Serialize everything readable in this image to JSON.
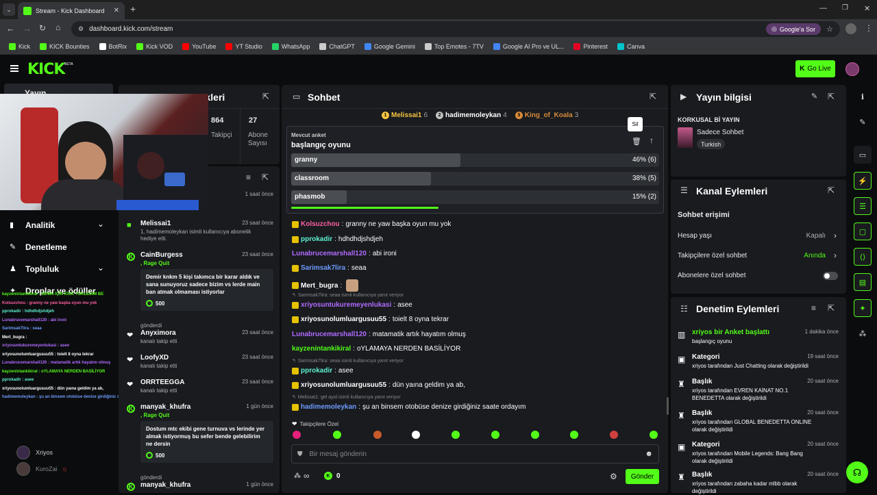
{
  "browser": {
    "tab_title": "Stream - Kick Dashboard",
    "url": "dashboard.kick.com/stream",
    "google_ask": "Google'a Sor",
    "bookmarks": [
      "Kick",
      "KICK Bounties",
      "BotRix",
      "Kick VOD",
      "YouTube",
      "YT Studio",
      "WhatsApp",
      "ChatGPT",
      "Google Gemini",
      "Top Emotes - 7TV",
      "Google AI Pro ve UL...",
      "Pinterest",
      "Canva"
    ]
  },
  "header": {
    "logo": "KICK",
    "beta": "BETA",
    "go_live": "Go Live"
  },
  "sidebar": {
    "stream_label": "Yayın",
    "items": [
      {
        "label": "Analitik",
        "chevron": true
      },
      {
        "label": "Denetleme",
        "chevron": false
      },
      {
        "label": "Topluluk",
        "chevron": true
      },
      {
        "label": "Droplar ve ödüller",
        "chevron": false
      }
    ],
    "accounts": [
      "Xriyos",
      "KuroZai"
    ]
  },
  "stats": {
    "title": "Yayın istatistikleri",
    "followers": "864",
    "followers_label": "Takipçi",
    "subs": "27",
    "subs_label": "Abone Sayısı"
  },
  "feed": {
    "items": [
      {
        "name": "",
        "sub": "kanalı takip etti",
        "time": "1 saat önce",
        "type": "heart"
      },
      {
        "name": "Melissai1",
        "sub": "1, hadimemoleykan isimli kullanıcıya abonelik hediye etti.",
        "time": "23 saat önce",
        "type": "gift"
      },
      {
        "name": "CainBurgess",
        "sub": ", Rage Quit",
        "time": "23 saat önce",
        "type": "kick",
        "message": "Demir knkm 5 kişi takımca bir karar aldık ve sana sunuyoruz sadece bizim vs lerde main ban atmak olmaması istiyorlar",
        "amount": "500",
        "footer": "gönderdi"
      },
      {
        "name": "Anyximora",
        "sub": "kanalı takip etti",
        "time": "23 saat önce",
        "type": "heart"
      },
      {
        "name": "LoofyXD",
        "sub": "kanalı takip etti",
        "time": "23 saat önce",
        "type": "heart"
      },
      {
        "name": "ORRTEEGGA",
        "sub": "kanalı takip etti",
        "time": "23 saat önce",
        "type": "heart"
      },
      {
        "name": "manyak_khufra",
        "sub": ", Rage Quit",
        "time": "1 gün önce",
        "type": "kick",
        "message": "Dostum mtc ekibi gene turnuva vs lerinde yer almak istiyormuş bu sefer bende gelebilirim ne dersin",
        "amount": "500",
        "footer": "gönderdi"
      },
      {
        "name": "manyak_khufra",
        "sub": "",
        "time": "1 gün önce",
        "type": "kick"
      }
    ]
  },
  "chat": {
    "title": "Sohbet",
    "leaders": [
      {
        "rank": "1",
        "name": "Melissai1",
        "count": "6",
        "color": "#f5c542"
      },
      {
        "rank": "2",
        "name": "hadimemoleykan",
        "count": "4",
        "color": "#c0c0c0"
      },
      {
        "rank": "3",
        "name": "King_of_Koala",
        "count": "3",
        "color": "#d98c3a"
      }
    ],
    "poll": {
      "label": "Mevcut anket",
      "question": "başlangıç oyunu",
      "tooltip": "Sil",
      "options": [
        {
          "label": "granny",
          "pct_text": "46% (6)",
          "fraction": 0.46
        },
        {
          "label": "classroom",
          "pct_text": "38% (5)",
          "fraction": 0.38
        },
        {
          "label": "phasmob",
          "pct_text": "15% (2)",
          "fraction": 0.15
        }
      ],
      "timer_fraction": 0.4
    },
    "messages": [
      {
        "user": "Kolsuzchou",
        "color": "#ff5fa2",
        "text": "granny ne yaw başka oyun mu yok"
      },
      {
        "user": "pprokadir",
        "color": "#5ef0d0",
        "text": "hdhdhdjshdjeh"
      },
      {
        "user": "Lunabrucemarshall120",
        "color": "#b06bff",
        "text": "abi ironi"
      },
      {
        "user": "Sarimsak7lira",
        "color": "#6f9bff",
        "text": "seaa"
      },
      {
        "user": "Mert_bugra",
        "color": "#ffffff",
        "text": ""
      },
      {
        "reply": "Sarimsak7lira: seaa isimli kullanıcıya yanıt veriyor",
        "user": "xriyosuntukuremeyenlukasi",
        "color": "#b06bff",
        "text": "asee"
      },
      {
        "user": "xriyosunolumluargusuu55",
        "color": "#ffffff",
        "text": "toielt 8 oyna tekrar"
      },
      {
        "user": "Lunabrucemarshall120",
        "color": "#b06bff",
        "text": "matamatik artık hayatım olmuş"
      },
      {
        "user": "kayzenintankikiral",
        "color": "#53fc18",
        "text": "oYLAMAYA NERDEN BASİLİYOR"
      },
      {
        "reply": "Sarimsak7lira: seaa isimli kullanıcıya yanıt veriyor",
        "user": "pprokadir",
        "color": "#5ef0d0",
        "text": "asee"
      },
      {
        "user": "xriyosunolumluargusuu55",
        "color": "#ffffff",
        "text": "dün yaına geldim ya ab,"
      },
      {
        "reply": "Melissai1: gel ayol isimli kullanıcıya yanıt veriyor",
        "user": "hadimemoleykan",
        "color": "#6f9bff",
        "text": "şu an binsem otobüse denize girdiğiniz saate ordayım"
      }
    ],
    "followers_only": "Takipçilere Özel",
    "input_placeholder": "Bir mesaj gönderin",
    "infinity": "∞",
    "points": "0",
    "send": "Gönder"
  },
  "stream_info": {
    "title": "Yayın bilgisi",
    "stream_title": "KORKUSAL Bİ YAYIN",
    "category": "Sadece Sohbet",
    "language": "Turkish"
  },
  "channel_actions": {
    "title": "Kanal Eylemleri",
    "section": "Sohbet erişimi",
    "rows": [
      {
        "label": "Hesap yaşı",
        "value": "Kapalı",
        "value_color": "#aeb0b5"
      },
      {
        "label": "Takipçilere özel sohbet",
        "value": "Anında",
        "value_color": "#53fc18"
      },
      {
        "label": "Abonelere özel sohbet",
        "value": "",
        "value_color": "#aeb0b5"
      }
    ]
  },
  "mod_actions": {
    "title": "Denetim Eylemleri",
    "rows": [
      {
        "title": "xriyos bir Anket başlattı",
        "desc": "başlangıç oyunu",
        "time": "1 dakika önce"
      },
      {
        "title": "Kategori",
        "desc": "xriyos tarafından Just Chatting olarak değiştirildi",
        "time": "19 saat önce"
      },
      {
        "title": "Başlık",
        "desc": "xriyos tarafından EVREN KAİNAT NO.1 BENEDETTA olarak değiştirildi",
        "time": "20 saat önce"
      },
      {
        "title": "Başlık",
        "desc": "xriyos tarafından GLOBAL BENEDETTA ONLINE olarak değiştirildi",
        "time": "20 saat önce"
      },
      {
        "title": "Kategori",
        "desc": "xriyos tarafından Mobile Legends: Bang Bang olarak değiştirildi",
        "time": "20 saat önce"
      },
      {
        "title": "Başlık",
        "desc": "xriyos tarafından zabaha kadar mlbb olarak değiştirildi",
        "time": "20 saat önce"
      }
    ]
  },
  "stream_overlay_chat": [
    {
      "text": "kayzenintankikiral : SENİN İÇİN KİCK YÜKLEDİM BE",
      "color": "#53fc18"
    },
    {
      "text": "Kolsuzchou : granny ne yaw başka oyun mu yok",
      "color": "#ff5fa2"
    },
    {
      "text": "pprokadir : hdhdhdjshdjeh",
      "color": "#5ef0d0"
    },
    {
      "text": "Lunabrucemarshall120 : abi ironi",
      "color": "#b06bff"
    },
    {
      "text": "Sarimsak7lira : seaa",
      "color": "#6f9bff"
    },
    {
      "text": "Mert_bugra :",
      "color": "#ffffff"
    },
    {
      "text": "xriyosuntukuremeyenlukasi : asee",
      "color": "#b06bff"
    },
    {
      "text": "xriyosunolumluargusuu55 : toielt 8 oyna tekrar",
      "color": "#ffffff"
    },
    {
      "text": "Lunabrucemarshall120 : matamatik artık hayatım olmuş",
      "color": "#b06bff"
    },
    {
      "text": "kayzenintankikiral : oYLAMAYA NERDEN BASİLİYOR",
      "color": "#53fc18"
    },
    {
      "text": "pprokadir : asee",
      "color": "#5ef0d0"
    },
    {
      "text": "xriyosunolumluargusuu55 : dün yaına geldim ya ab,",
      "color": "#ffffff"
    },
    {
      "text": "hadimemoleykan : şu an binsem otobüse denize girdiğiniz saate ordayım",
      "color": "#6f9bff"
    }
  ]
}
